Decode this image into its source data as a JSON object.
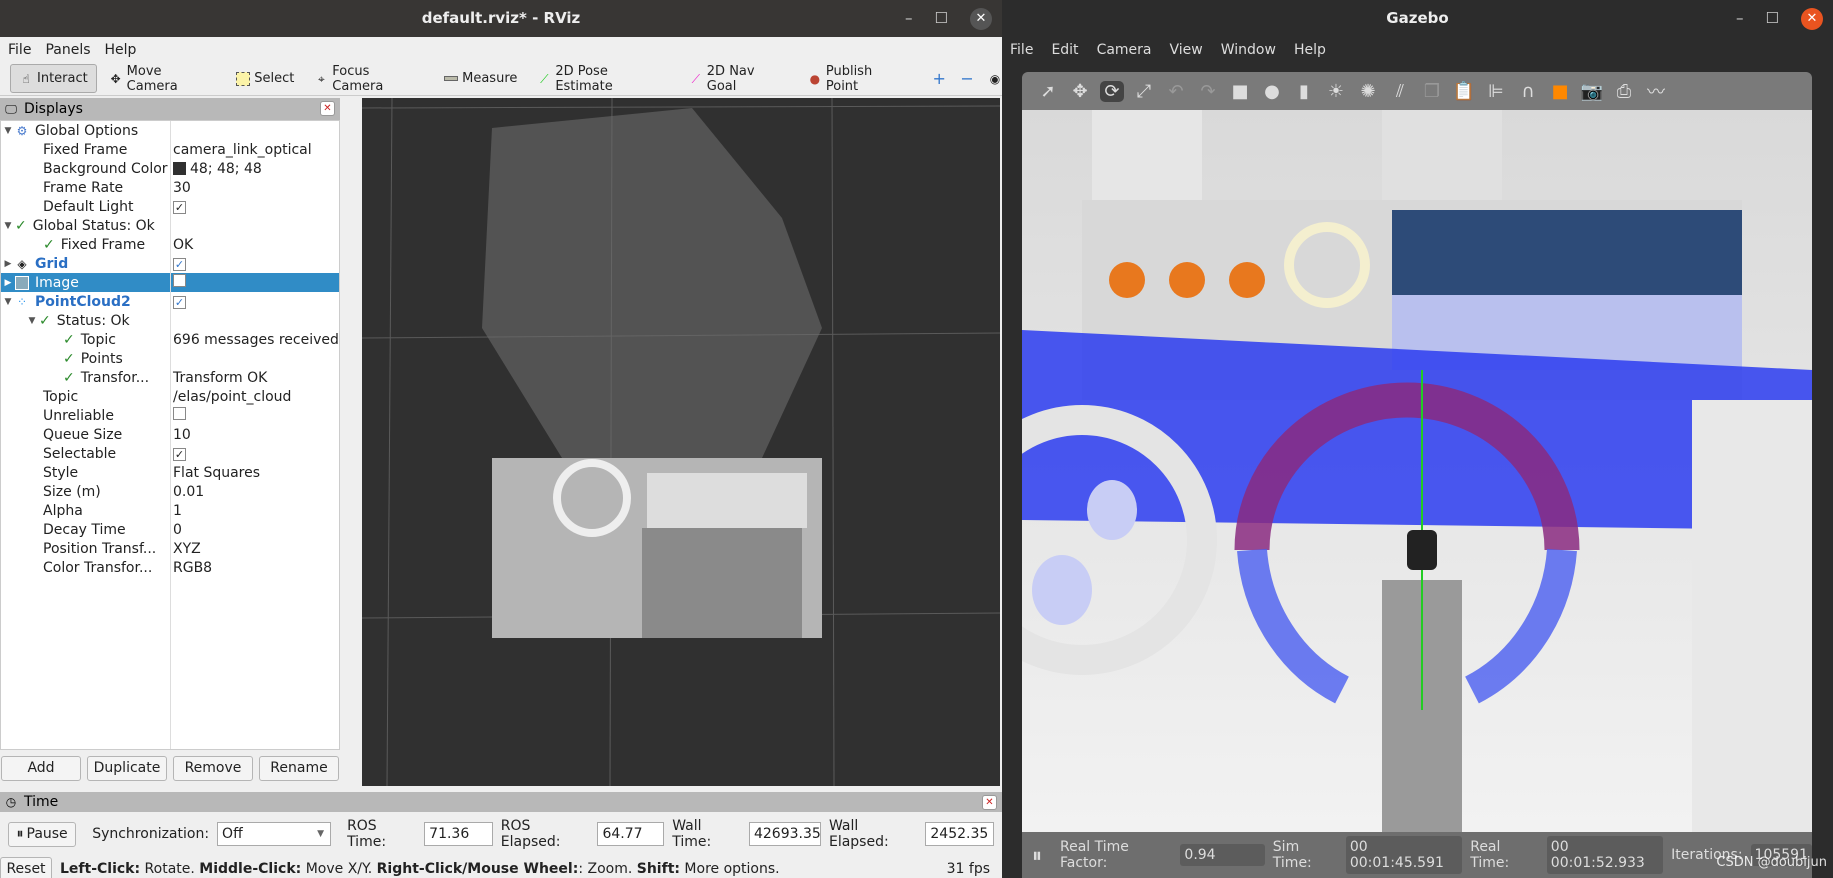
{
  "rviz": {
    "title": "default.rviz* - RViz",
    "menu": [
      "File",
      "Panels",
      "Help"
    ],
    "tools": [
      {
        "label": "Interact",
        "icon": "hand-icon",
        "active": true
      },
      {
        "label": "Move Camera",
        "icon": "move-camera-icon"
      },
      {
        "label": "Select",
        "icon": "select-icon"
      },
      {
        "label": "Focus Camera",
        "icon": "focus-camera-icon"
      },
      {
        "label": "Measure",
        "icon": "ruler-icon"
      },
      {
        "label": "2D Pose Estimate",
        "icon": "green-arrow-icon"
      },
      {
        "label": "2D Nav Goal",
        "icon": "pink-arrow-icon"
      },
      {
        "label": "Publish Point",
        "icon": "map-pin-icon"
      }
    ],
    "displays": {
      "title": "Displays",
      "rows": [
        {
          "k": "Global Options",
          "v": ""
        },
        {
          "k": "Fixed Frame",
          "v": "camera_link_optical"
        },
        {
          "k": "Background Color",
          "v": "48; 48; 48",
          "color": "#303030"
        },
        {
          "k": "Frame Rate",
          "v": "30"
        },
        {
          "k": "Default Light",
          "v": ""
        },
        {
          "k": "Global Status: Ok",
          "v": ""
        },
        {
          "k": "Fixed Frame",
          "v": "OK"
        },
        {
          "k": "Grid",
          "v": ""
        },
        {
          "k": "Image",
          "v": ""
        },
        {
          "k": "PointCloud2",
          "v": ""
        },
        {
          "k": "Status: Ok",
          "v": ""
        },
        {
          "k": "Topic",
          "v": "696 messages received"
        },
        {
          "k": "Points",
          "v": ""
        },
        {
          "k": "Transfor...",
          "v": "Transform OK"
        },
        {
          "k": "Topic",
          "v": "/elas/point_cloud"
        },
        {
          "k": "Unreliable",
          "v": ""
        },
        {
          "k": "Queue Size",
          "v": "10"
        },
        {
          "k": "Selectable",
          "v": ""
        },
        {
          "k": "Style",
          "v": "Flat Squares"
        },
        {
          "k": "Size (m)",
          "v": "0.01"
        },
        {
          "k": "Alpha",
          "v": "1"
        },
        {
          "k": "Decay Time",
          "v": "0"
        },
        {
          "k": "Position Transf...",
          "v": "XYZ"
        },
        {
          "k": "Color Transfor...",
          "v": "RGB8"
        }
      ],
      "buttons": [
        "Add",
        "Duplicate",
        "Remove",
        "Rename"
      ]
    },
    "time": {
      "title": "Time",
      "pause": "Pause",
      "sync_label": "Synchronization:",
      "sync_value": "Off",
      "ros_time_label": "ROS Time:",
      "ros_time": "71.36",
      "ros_elapsed_label": "ROS Elapsed:",
      "ros_elapsed": "64.77",
      "wall_time_label": "Wall Time:",
      "wall_time": "42693.35",
      "wall_elapsed_label": "Wall Elapsed:",
      "wall_elapsed": "2452.35"
    },
    "status": {
      "reset": "Reset",
      "h1": "Left-Click:",
      "t1": " Rotate. ",
      "h2": "Middle-Click:",
      "t2": " Move X/Y. ",
      "h3": "Right-Click/Mouse Wheel:",
      "t3": ": Zoom. ",
      "h4": "Shift:",
      "t4": " More options.",
      "fps": "31 fps"
    }
  },
  "gazebo": {
    "title": "Gazebo",
    "menu": [
      "File",
      "Edit",
      "Camera",
      "View",
      "Window",
      "Help"
    ],
    "bottom": {
      "rtf_label": "Real Time Factor:",
      "rtf": "0.94",
      "sim_label": "Sim Time:",
      "sim": "00 00:01:45.591",
      "real_label": "Real Time:",
      "real": "00 00:01:52.933",
      "iter_label": "Iterations:",
      "iter": "105591"
    },
    "watermark": "CSDN @doubijun"
  }
}
